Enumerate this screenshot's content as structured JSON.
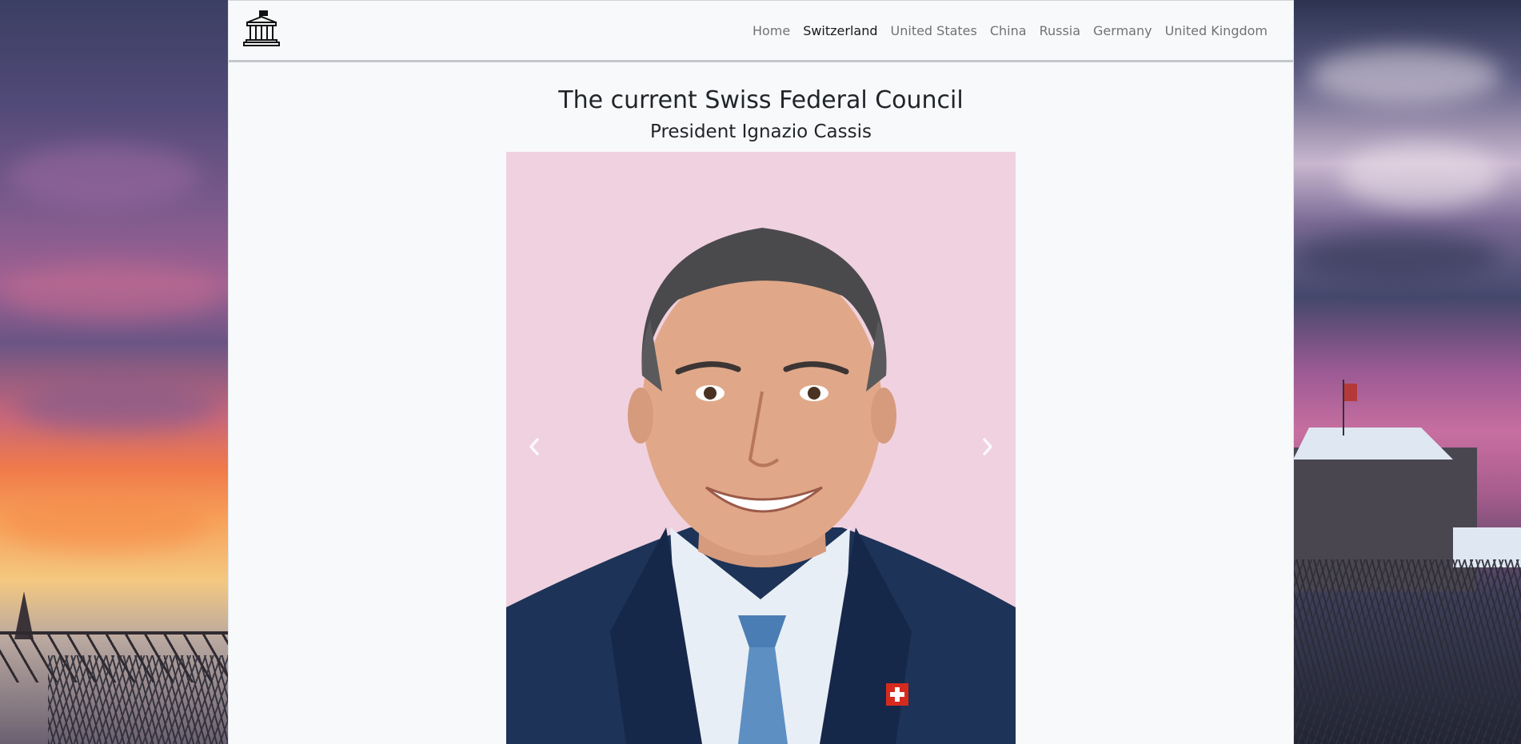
{
  "nav": {
    "logo_icon": "government-building-icon",
    "links": [
      {
        "label": "Home",
        "active": false
      },
      {
        "label": "Switzerland",
        "active": true
      },
      {
        "label": "United States",
        "active": false
      },
      {
        "label": "China",
        "active": false
      },
      {
        "label": "Russia",
        "active": false
      },
      {
        "label": "Germany",
        "active": false
      },
      {
        "label": "United Kingdom",
        "active": false
      }
    ]
  },
  "main": {
    "title": "The current Swiss Federal Council",
    "subtitle": "President Ignazio Cassis"
  },
  "carousel": {
    "prev_icon": "chevron-left-icon",
    "next_icon": "chevron-right-icon",
    "image_background": "#f0d1df"
  }
}
